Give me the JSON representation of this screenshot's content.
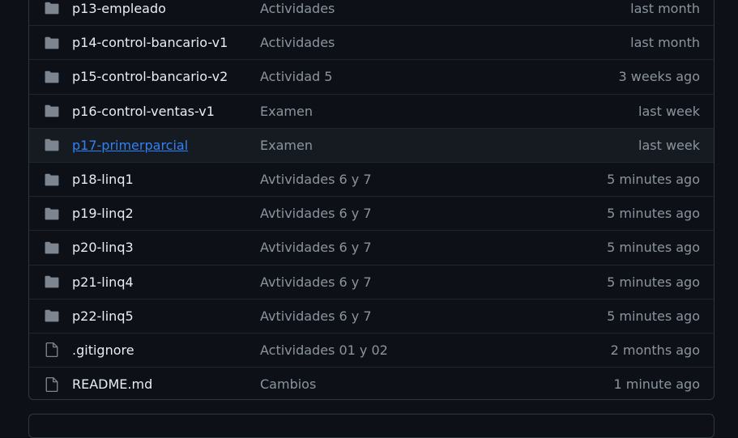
{
  "files": [
    {
      "type": "folder",
      "icon": "folder-icon",
      "name": "p13-empleado",
      "message": "Actividades",
      "age": "last month"
    },
    {
      "type": "folder",
      "icon": "folder-icon",
      "name": "p14-control-bancario-v1",
      "message": "Actividades",
      "age": "last month"
    },
    {
      "type": "folder",
      "icon": "folder-icon",
      "name": "p15-control-bancario-v2",
      "message": "Actividad 5",
      "age": "3 weeks ago"
    },
    {
      "type": "folder",
      "icon": "folder-icon",
      "name": "p16-control-ventas-v1",
      "message": "Examen",
      "age": "last week"
    },
    {
      "type": "folder",
      "icon": "folder-icon",
      "name": "p17-primerparcial",
      "message": "Examen",
      "age": "last week",
      "hovered": true
    },
    {
      "type": "folder",
      "icon": "folder-icon",
      "name": "p18-linq1",
      "message": "Avtividades 6 y 7",
      "age": "5 minutes ago"
    },
    {
      "type": "folder",
      "icon": "folder-icon",
      "name": "p19-linq2",
      "message": "Avtividades 6 y 7",
      "age": "5 minutes ago"
    },
    {
      "type": "folder",
      "icon": "folder-icon",
      "name": "p20-linq3",
      "message": "Avtividades 6 y 7",
      "age": "5 minutes ago"
    },
    {
      "type": "folder",
      "icon": "folder-icon",
      "name": "p21-linq4",
      "message": "Avtividades 6 y 7",
      "age": "5 minutes ago"
    },
    {
      "type": "folder",
      "icon": "folder-icon",
      "name": "p22-linq5",
      "message": "Avtividades 6 y 7",
      "age": "5 minutes ago"
    },
    {
      "type": "file",
      "icon": "file-icon",
      "name": ".gitignore",
      "message": "Actividades 01 y 02",
      "age": "2 months ago"
    },
    {
      "type": "file",
      "icon": "file-icon",
      "name": "README.md",
      "message": "Cambios",
      "age": "1 minute ago"
    }
  ],
  "colors": {
    "background": "#0d1117",
    "row_hover": "#161b22",
    "border": "#30363d",
    "text_primary": "#e6edf3",
    "text_muted": "#8b949e",
    "link": "#2f81f7",
    "icon": "#7d8590"
  }
}
